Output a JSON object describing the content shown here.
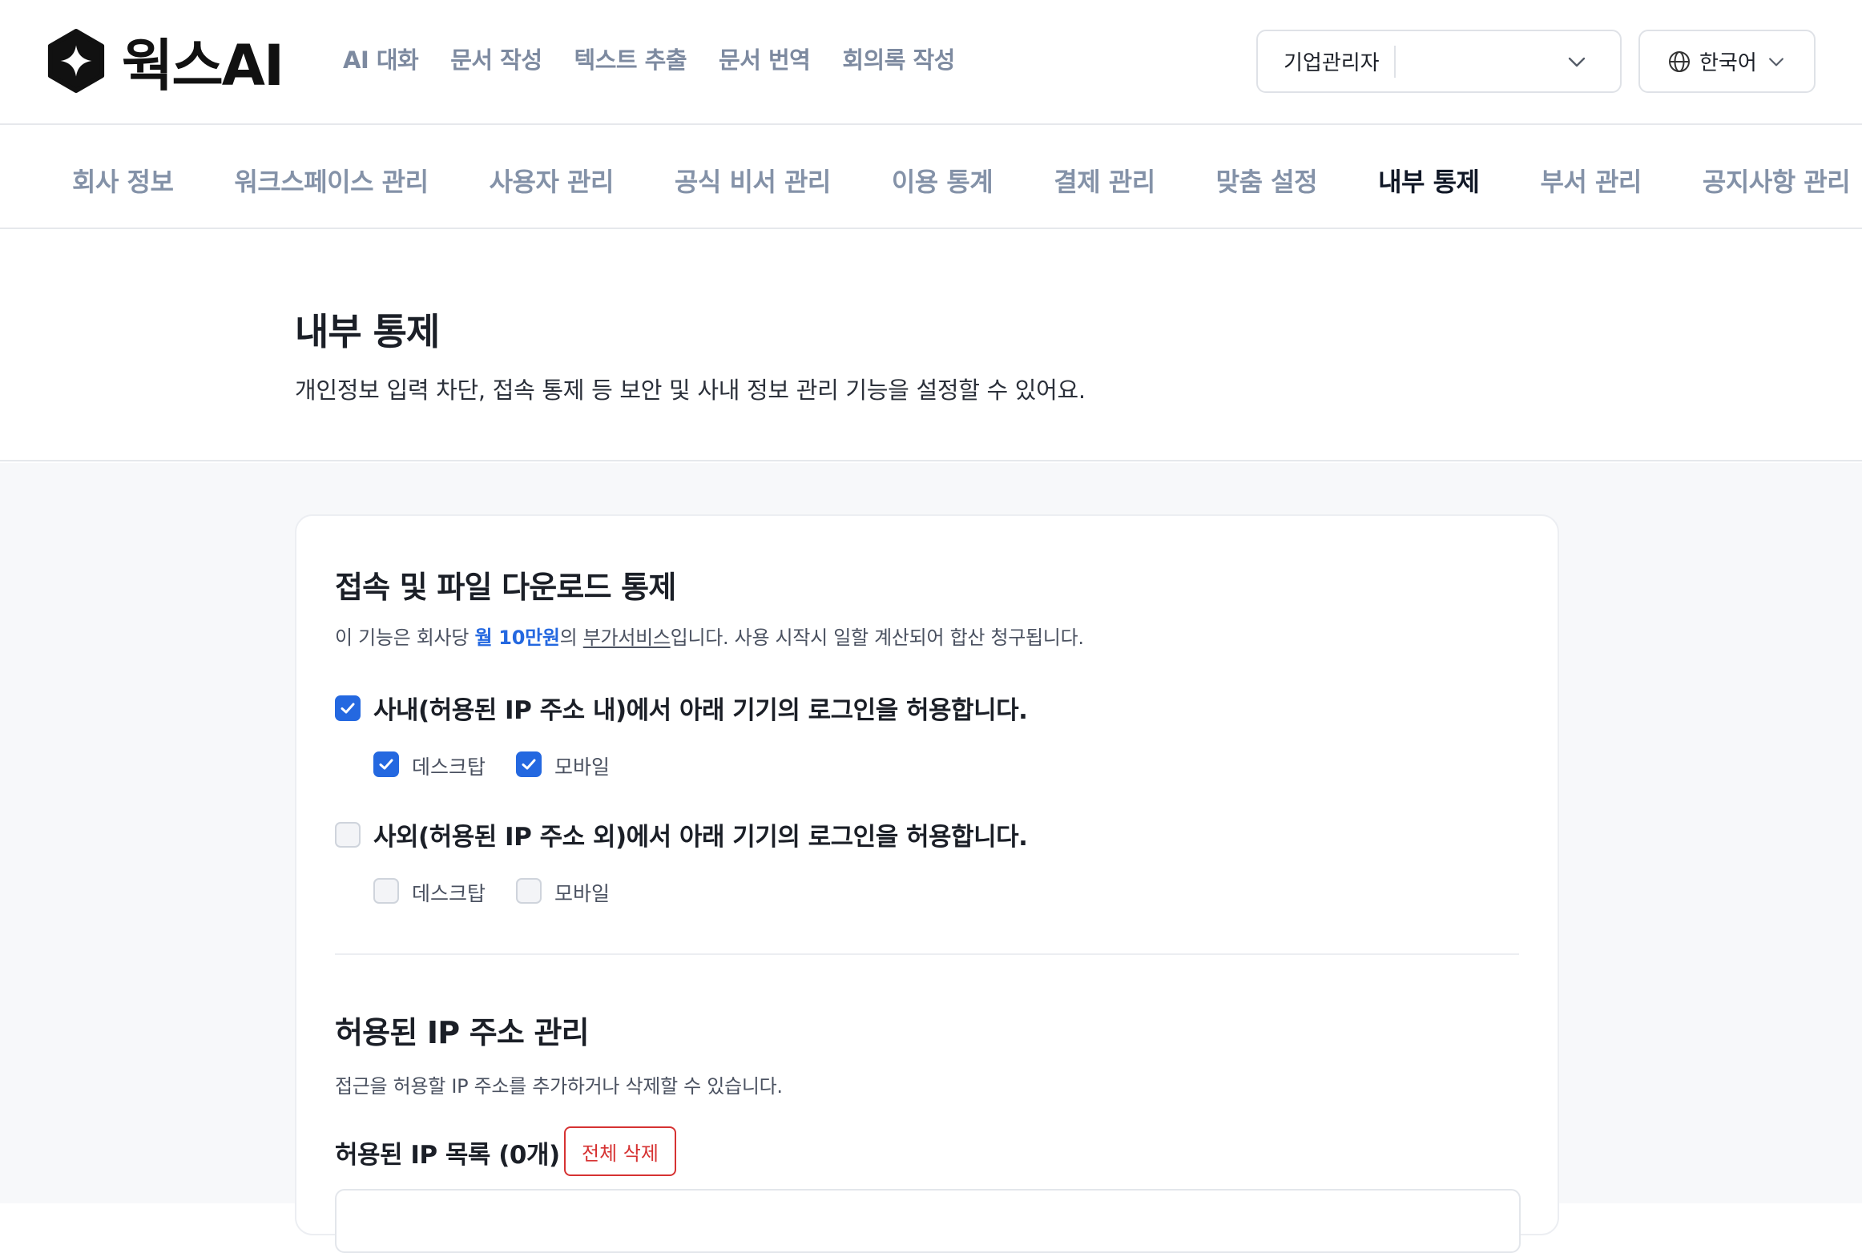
{
  "header": {
    "logo_text": "웍스AI",
    "nav": [
      "AI 대화",
      "문서 작성",
      "텍스트 추출",
      "문서 번역",
      "회의록 작성"
    ],
    "company_select": {
      "value": "기업관리자"
    },
    "language_select": {
      "value": "한국어"
    }
  },
  "subnav": {
    "items": [
      "회사 정보",
      "워크스페이스 관리",
      "사용자 관리",
      "공식 비서 관리",
      "이용 통계",
      "결제 관리",
      "맞춤 설정",
      "내부 통제",
      "부서 관리",
      "공지사항 관리"
    ],
    "active": "내부 통제"
  },
  "page": {
    "title": "내부 통제",
    "description": "개인정보 입력 차단, 접속 통제 등 보안 및 사내 정보 관리 기능을 설정할 수 있어요."
  },
  "access_control": {
    "title": "접속 및 파일 다운로드 통제",
    "desc_prefix": "이 기능은 회사당 ",
    "desc_price": "월 10만원",
    "desc_mid": "의 ",
    "desc_link": "부가서비스",
    "desc_suffix": "입니다. 사용 시작시 일할 계산되어 합산 청구됩니다.",
    "internal": {
      "label": "사내(허용된 IP 주소 내)에서 아래 기기의 로그인을 허용합니다.",
      "checked": true,
      "desktop": {
        "label": "데스크탑",
        "checked": true
      },
      "mobile": {
        "label": "모바일",
        "checked": true
      }
    },
    "external": {
      "label": "사외(허용된 IP 주소 외)에서 아래 기기의 로그인을 허용합니다.",
      "checked": false,
      "desktop": {
        "label": "데스크탑",
        "checked": false
      },
      "mobile": {
        "label": "모바일",
        "checked": false
      }
    }
  },
  "ip_management": {
    "title": "허용된 IP 주소 관리",
    "description": "접근을 허용할 IP 주소를 추가하거나 삭제할 수 있습니다.",
    "list_title": "허용된 IP 목록 (0개)",
    "delete_all_label": "전체 삭제"
  }
}
